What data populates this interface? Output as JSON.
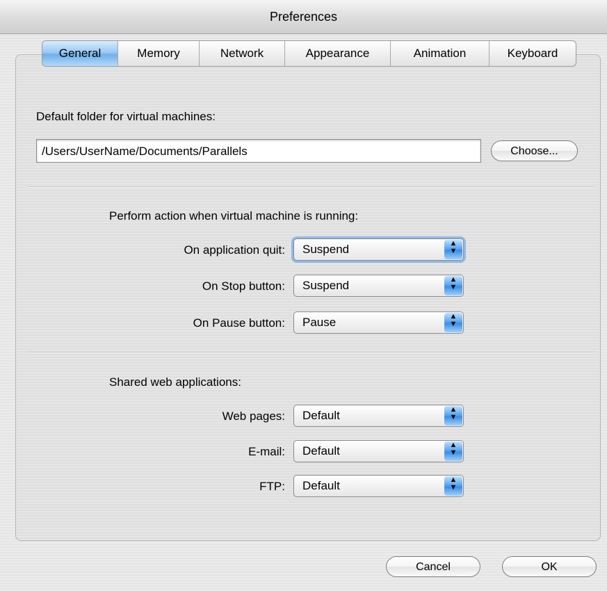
{
  "window": {
    "title": "Preferences"
  },
  "tabs": [
    {
      "label": "General",
      "active": true
    },
    {
      "label": "Memory"
    },
    {
      "label": "Network"
    },
    {
      "label": "Appearance"
    },
    {
      "label": "Animation"
    },
    {
      "label": "Keyboard"
    }
  ],
  "general": {
    "folder_label": "Default folder for virtual machines:",
    "folder_value": "/Users/UserName/Documents/Parallels",
    "choose_label": "Choose...",
    "running_label": "Perform action when virtual machine is running:",
    "on_quit_label": "On application quit:",
    "on_quit_value": "Suspend",
    "on_stop_label": "On Stop button:",
    "on_stop_value": "Suspend",
    "on_pause_label": "On Pause button:",
    "on_pause_value": "Pause",
    "shared_label": "Shared web applications:",
    "web_label": "Web pages:",
    "web_value": "Default",
    "email_label": "E-mail:",
    "email_value": "Default",
    "ftp_label": "FTP:",
    "ftp_value": "Default"
  },
  "footer": {
    "cancel_label": "Cancel",
    "ok_label": "OK"
  },
  "icons": {
    "popup_arrows": "updown-arrows-icon"
  }
}
